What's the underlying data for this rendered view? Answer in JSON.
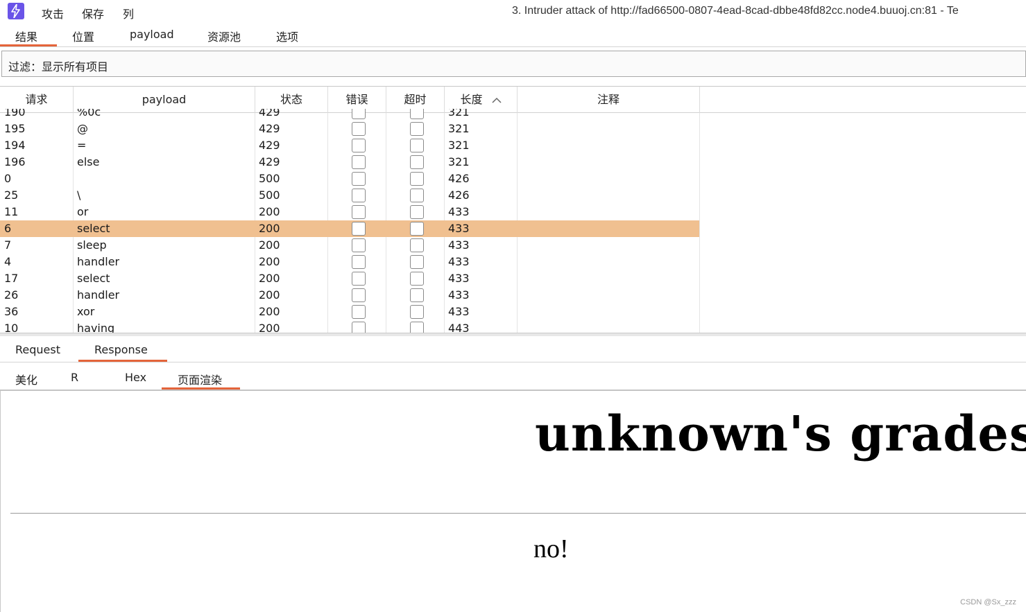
{
  "menu": {
    "items": [
      "攻击",
      "保存",
      "列"
    ],
    "window_title": "3. Intruder attack of http://fad66500-0807-4ead-8cad-dbbe48fd82cc.node4.buuoj.cn:81 - Te"
  },
  "main_tabs": [
    "结果",
    "位置",
    "payload",
    "资源池",
    "选项"
  ],
  "active_main_tab": "结果",
  "filter": {
    "label": "过滤：显示所有项目"
  },
  "table": {
    "columns": [
      "请求",
      "payload",
      "状态",
      "错误",
      "超时",
      "长度",
      "注释"
    ],
    "sort_column": "长度",
    "rows": [
      {
        "req": "190",
        "payload": "%0c",
        "status": "429",
        "length": "321"
      },
      {
        "req": "195",
        "payload": "@",
        "status": "429",
        "length": "321"
      },
      {
        "req": "194",
        "payload": "=",
        "status": "429",
        "length": "321"
      },
      {
        "req": "196",
        "payload": "else",
        "status": "429",
        "length": "321"
      },
      {
        "req": "0",
        "payload": "",
        "status": "500",
        "length": "426"
      },
      {
        "req": "25",
        "payload": "\\",
        "status": "500",
        "length": "426"
      },
      {
        "req": "11",
        "payload": "or",
        "status": "200",
        "length": "433"
      },
      {
        "req": "6",
        "payload": "select",
        "status": "200",
        "length": "433",
        "selected": true
      },
      {
        "req": "7",
        "payload": "sleep",
        "status": "200",
        "length": "433"
      },
      {
        "req": "4",
        "payload": "handler",
        "status": "200",
        "length": "433"
      },
      {
        "req": "17",
        "payload": "select",
        "status": "200",
        "length": "433"
      },
      {
        "req": "26",
        "payload": "handler",
        "status": "200",
        "length": "433"
      },
      {
        "req": "36",
        "payload": "xor",
        "status": "200",
        "length": "433"
      },
      {
        "req": "10",
        "payload": "having",
        "status": "200",
        "length": "443"
      }
    ]
  },
  "sub_tabs": [
    "Request",
    "Response"
  ],
  "active_sub_tab": "Response",
  "view_tabs": [
    "美化",
    "R",
    "Hex",
    "页面渲染"
  ],
  "active_view_tab": "页面渲染",
  "render": {
    "heading": "unknown's grades",
    "message": "no!"
  },
  "watermark": "CSDN @Sx_zzz",
  "colors": {
    "accent": "#e4643a",
    "selected_row": "#f0c090",
    "app_icon": "#6a54e8"
  }
}
